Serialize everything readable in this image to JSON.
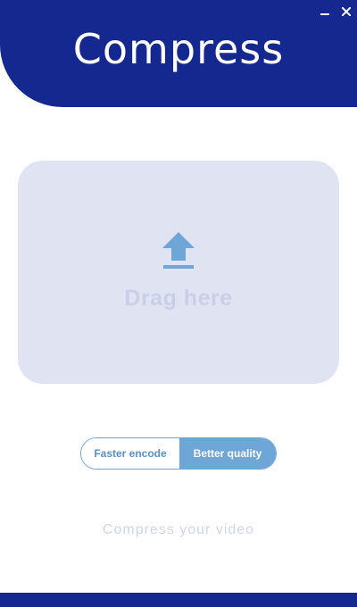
{
  "app": {
    "title": "Compress"
  },
  "window_controls": {
    "minimize_icon": "minimize-icon",
    "close_icon": "close-icon"
  },
  "dropzone": {
    "icon": "upload-icon",
    "label": "Drag here"
  },
  "mode_toggle": {
    "options": [
      "Faster encode",
      "Better quality"
    ],
    "selected": "Better quality"
  },
  "footer": {
    "text": "Compress your video"
  },
  "colors": {
    "brand_blue": "#14288f",
    "accent_blue": "#6ea6d8",
    "dropzone_bg": "#e0e4f2",
    "muted_text": "#c9cfe8"
  }
}
